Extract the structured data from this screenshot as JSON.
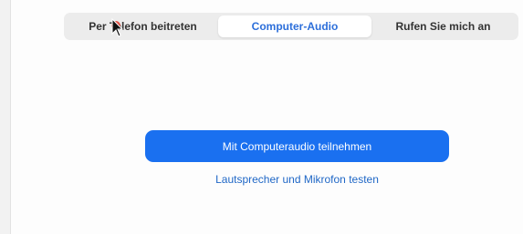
{
  "tabs": [
    {
      "label": "Per Telefon beitreten",
      "selected": false
    },
    {
      "label": "Computer-Audio",
      "selected": true
    },
    {
      "label": "Rufen Sie mich an",
      "selected": false
    }
  ],
  "main": {
    "join_button_label": "Mit Computeraudio teilnehmen",
    "test_link_label": "Lautsprecher und Mikrofon testen"
  },
  "colors": {
    "accent": "#1a70f0",
    "link": "#1f67c6",
    "selected_tab_text": "#2d6fda",
    "tab_bar_bg": "#ececec",
    "cursor_highlight": "#e23a2a"
  },
  "icons": {
    "cursor": "mouse-pointer-icon"
  }
}
